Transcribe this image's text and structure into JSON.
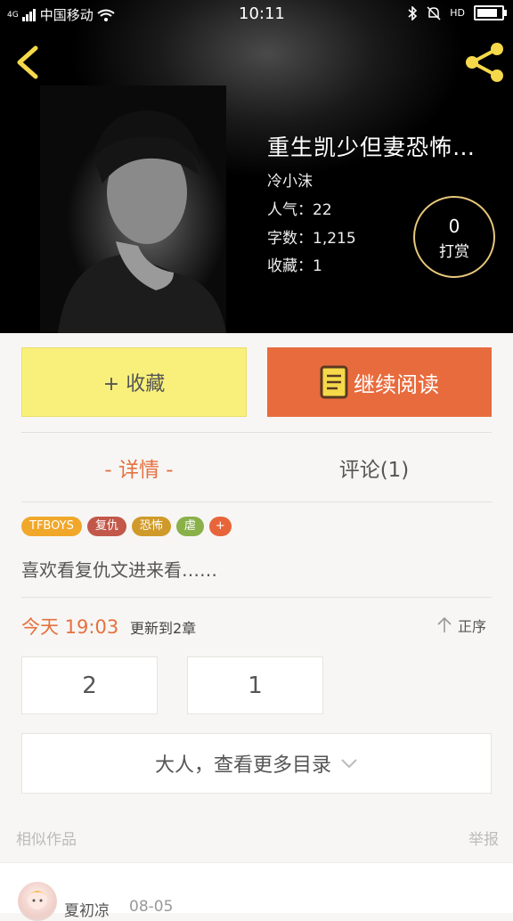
{
  "status_bar": {
    "signal": "4G",
    "carrier": "中国移动",
    "time": "10:11",
    "hd": "HD"
  },
  "book": {
    "title": "重生凯少但妻恐怖…",
    "author": "冷小沫",
    "popularity": "人气：22",
    "word_count": "字数：1,215",
    "favorites": "收藏：1",
    "tip_count": "0",
    "tip_label": "打赏"
  },
  "actions": {
    "favorite": "+ 收藏",
    "continue_reading": "继续阅读"
  },
  "tabs": {
    "detail": "- 详情 -",
    "comments": "评论(1)"
  },
  "tags": [
    {
      "label": "TFBOYS",
      "color": "#f0a72a"
    },
    {
      "label": "复仇",
      "color": "#c2584a"
    },
    {
      "label": "恐怖",
      "color": "#d09a2a"
    },
    {
      "label": "虐",
      "color": "#8ab04a"
    },
    {
      "label": "+",
      "color": "#e8653a"
    }
  ],
  "description": "喜欢看复仇文进来看……",
  "update": {
    "time": "今天 19:03",
    "text": "更新到2章",
    "sort_label": "正序"
  },
  "chapters": [
    "2",
    "1"
  ],
  "more_catalog": "大人，查看更多目录",
  "footer": {
    "similar": "相似作品",
    "report": "举报"
  },
  "comment": {
    "user": "夏初凉",
    "date": "08-05"
  },
  "colors": {
    "accent": "#e86b3d",
    "favorite_bg": "#f9f07c",
    "icon_yellow": "#f5d94a"
  }
}
